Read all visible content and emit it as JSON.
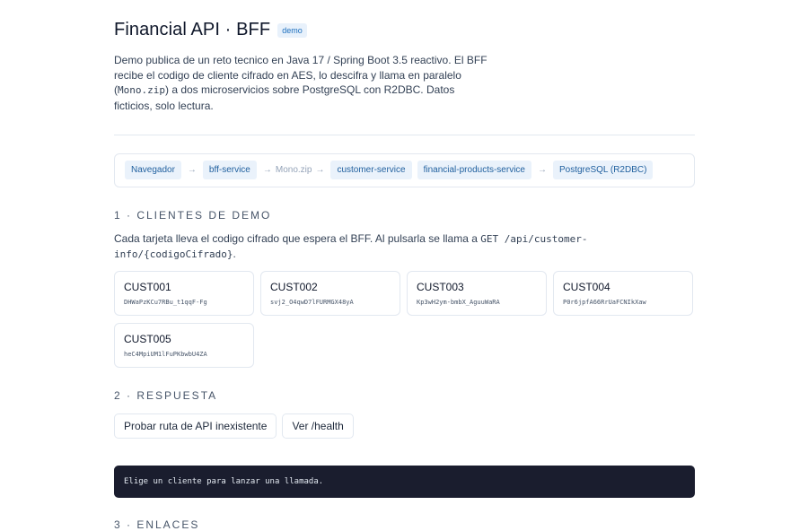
{
  "header": {
    "title": "Financial API · BFF",
    "badge": "demo"
  },
  "intro": {
    "part1": "Demo publica de un reto tecnico en Java 17 / Spring Boot 3.5 reactivo. El BFF recibe el codigo de cliente cifrado en AES, lo descifra y llama en paralelo (",
    "code": "Mono.zip",
    "part2": ") a dos microservicios sobre PostgreSQL con R2DBC. Datos ficticios, solo lectura."
  },
  "flow": {
    "node_browser": "Navegador",
    "node_bff": "bff-service",
    "zip_label": "Mono.zip",
    "node_customer": "customer-service",
    "node_financial": "financial-products-service",
    "node_db": "PostgreSQL (R2DBC)",
    "arrow": "→"
  },
  "section1": {
    "heading": "1 · Clientes de demo",
    "desc_part1": "Cada tarjeta lleva el codigo cifrado que espera el BFF. Al pulsarla se llama a ",
    "desc_code": "GET /api/customer-info/{codigoCifrado}",
    "desc_part2": ".",
    "cards": [
      {
        "id": "CUST001",
        "code": "DHWaPzKCu7RBu_t1qqF-Fg"
      },
      {
        "id": "CUST002",
        "code": "svj2_O4qwD7lFURMGX48yA"
      },
      {
        "id": "CUST003",
        "code": "Kp3wH2ym-bmbX_AguuWaRA"
      },
      {
        "id": "CUST004",
        "code": "P0r6jpfA66RrUaFCNIkXaw"
      },
      {
        "id": "CUST005",
        "code": "heC4MpiUM1lFuPKbwbU4ZA"
      }
    ]
  },
  "section2": {
    "heading": "2 · Respuesta",
    "btn_missing": "Probar ruta de API inexistente",
    "btn_health": "Ver /health",
    "console": "Elige un cliente para lanzar una llamada."
  },
  "section3": {
    "heading": "3 · Enlaces"
  }
}
